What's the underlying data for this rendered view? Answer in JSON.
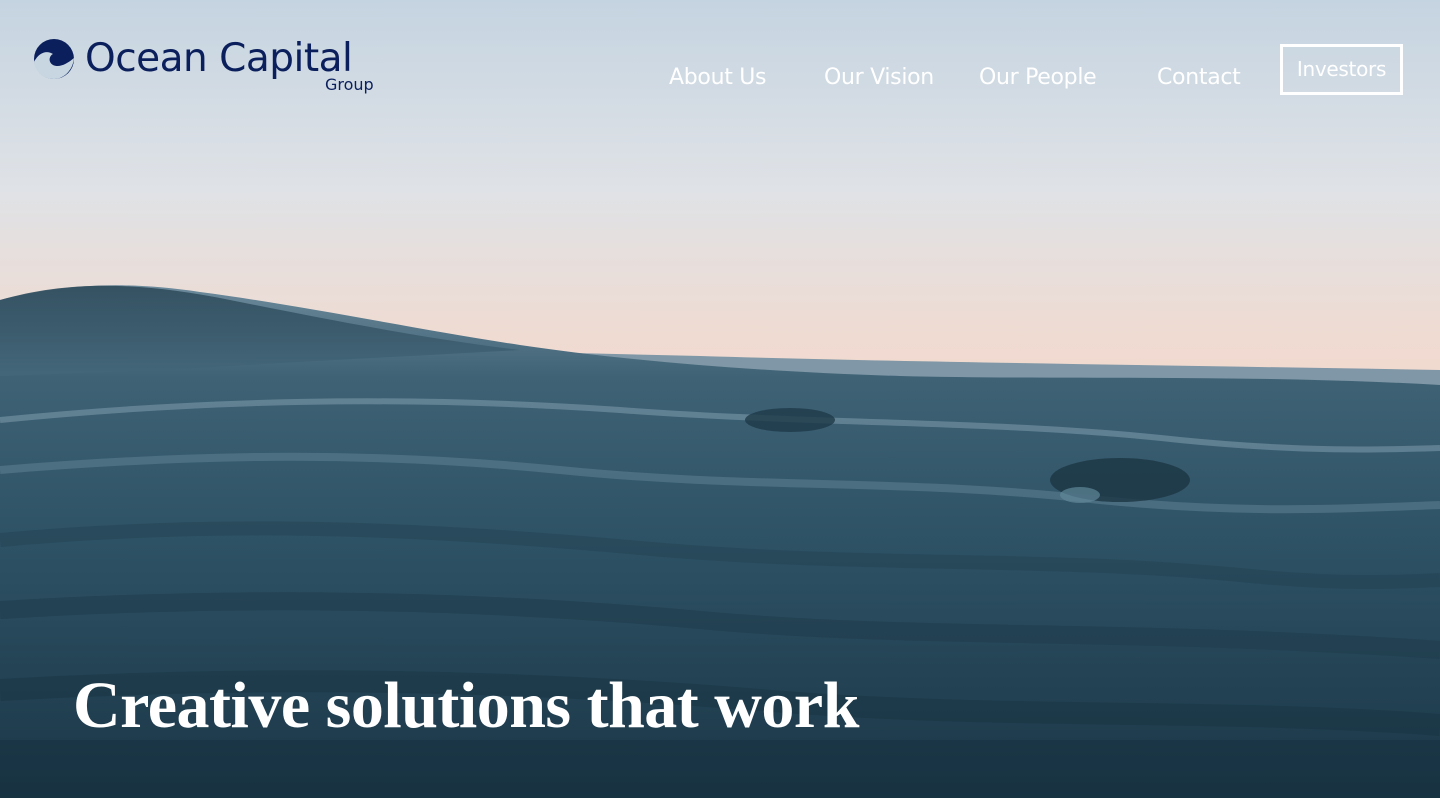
{
  "brand": {
    "name": "Ocean Capital",
    "sub": "Group",
    "color": "#0b1f5c"
  },
  "nav": {
    "items": [
      {
        "label": "About Us"
      },
      {
        "label": "Our Vision"
      },
      {
        "label": "Our People"
      },
      {
        "label": "Contact"
      }
    ],
    "cta_label": "Investors"
  },
  "hero": {
    "headline": "Creative solutions that work",
    "background": "ocean-wave-photo",
    "colors": {
      "sky_top": "#c9d7e3",
      "sky_horizon": "#f0d9cf",
      "water_light": "#5c7d8f",
      "water_dark": "#15303f"
    }
  }
}
